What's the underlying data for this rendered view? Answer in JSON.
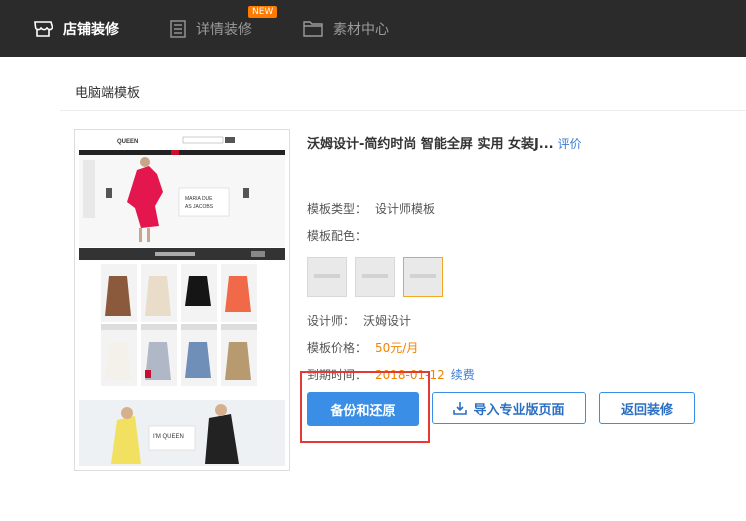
{
  "topbar": {
    "tabs": [
      {
        "label": "店铺装修",
        "icon": "store-icon",
        "active": true
      },
      {
        "label": "详情装修",
        "icon": "list-icon",
        "active": false,
        "badge": "NEW"
      },
      {
        "label": "素材中心",
        "icon": "folder-icon",
        "active": false
      }
    ]
  },
  "section": {
    "title": "电脑端模板"
  },
  "template": {
    "title": "沃姆设计-简约时尚 智能全屏 实用 女装J...",
    "eval_label": "评价",
    "type_label": "模板类型：",
    "type_value": "设计师模板",
    "color_label": "模板配色：",
    "designer_label": "设计师：",
    "designer_value": "沃姆设计",
    "price_label": "模板价格：",
    "price_value": "50元/月",
    "expire_label": "到期时间：",
    "expire_value": "2018-01-12",
    "renew_label": "续费",
    "preview": {
      "brand": "QUEEN",
      "hero_line1": "MARIA DUE",
      "hero_line2": "AS JACOBS",
      "banner": "I'M QUEEN"
    }
  },
  "buttons": {
    "backup": "备份和还原",
    "import": "导入专业版页面",
    "back": "返回装修"
  },
  "colors": {
    "topbar_bg": "#2b2b2b",
    "primary": "#3a8ee6",
    "price": "#f08300",
    "highlight": "#e53935",
    "badge": "#ff7a00"
  }
}
